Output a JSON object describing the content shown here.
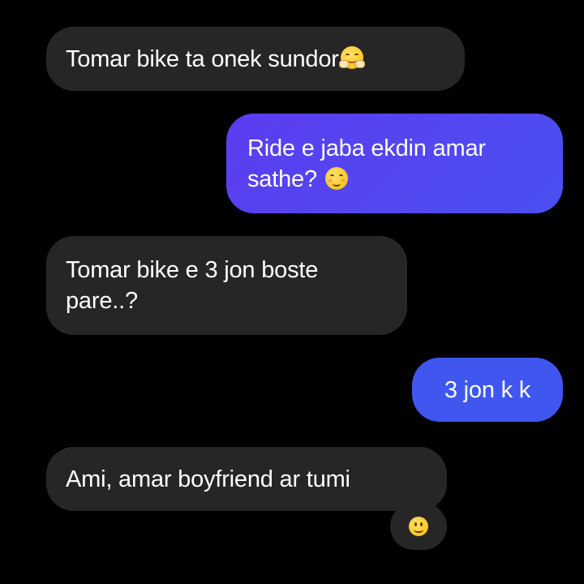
{
  "conversation": {
    "messages": [
      {
        "direction": "incoming",
        "text": "Tomar bike ta onek sundor",
        "emoji": "hugging-face-emoji"
      },
      {
        "direction": "outgoing",
        "text": "Ride e jaba ekdin amar\nsathe? ",
        "emoji": "relieved-face-emoji"
      },
      {
        "direction": "incoming",
        "text": "Tomar bike e 3 jon boste\npare..?",
        "emoji": ""
      },
      {
        "direction": "outgoing",
        "text": "3 jon k k",
        "emoji": ""
      },
      {
        "direction": "incoming",
        "text": "Ami, amar boyfriend ar tumi",
        "emoji": ""
      },
      {
        "direction": "incoming",
        "text": "",
        "emoji": "slightly-smiling-face-emoji"
      }
    ]
  },
  "colors": {
    "background": "#000000",
    "incoming_bubble": "#262626",
    "outgoing_bubble_primary": "#5b3df0",
    "outgoing_bubble_secondary": "#3f57ee",
    "text": "#ffffff"
  }
}
